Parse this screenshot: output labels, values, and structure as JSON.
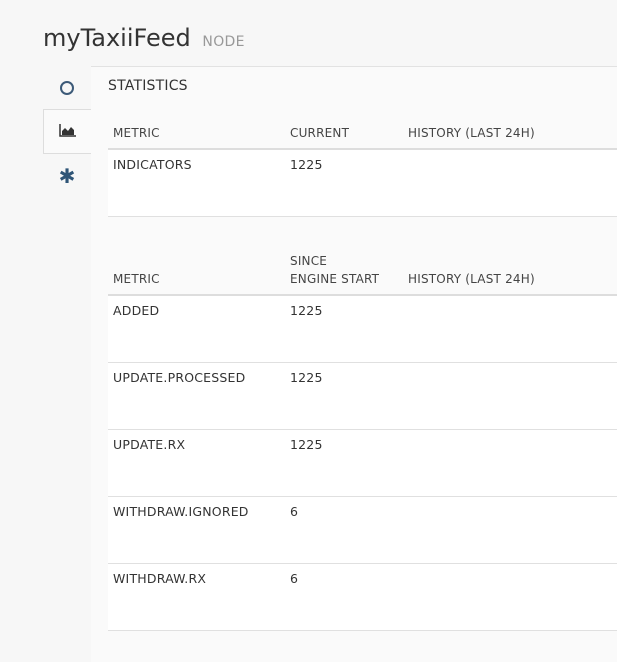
{
  "header": {
    "title": "myTaxiiFeed",
    "node_tag": "NODE"
  },
  "tabs": [
    {
      "name": "status",
      "icon": "circle-icon"
    },
    {
      "name": "statistics",
      "icon": "area-chart-icon",
      "active": true
    },
    {
      "name": "config",
      "icon": "asterisk-icon"
    }
  ],
  "panel": {
    "title": "STATISTICS"
  },
  "table1": {
    "headers": [
      "METRIC",
      "CURRENT",
      "HISTORY (LAST 24H)"
    ],
    "rows": [
      {
        "metric": "INDICATORS",
        "value": "1225"
      }
    ]
  },
  "table2": {
    "headers": [
      "METRIC",
      "SINCE",
      "ENGINE START",
      "HISTORY (LAST 24H)"
    ],
    "rows": [
      {
        "metric": "ADDED",
        "value": "1225"
      },
      {
        "metric": "UPDATE.PROCESSED",
        "value": "1225"
      },
      {
        "metric": "UPDATE.RX",
        "value": "1225"
      },
      {
        "metric": "WITHDRAW.IGNORED",
        "value": "6"
      },
      {
        "metric": "WITHDRAW.RX",
        "value": "6"
      }
    ]
  },
  "colors": {
    "icon": "#2f5577",
    "background": "#f7f7f7"
  }
}
